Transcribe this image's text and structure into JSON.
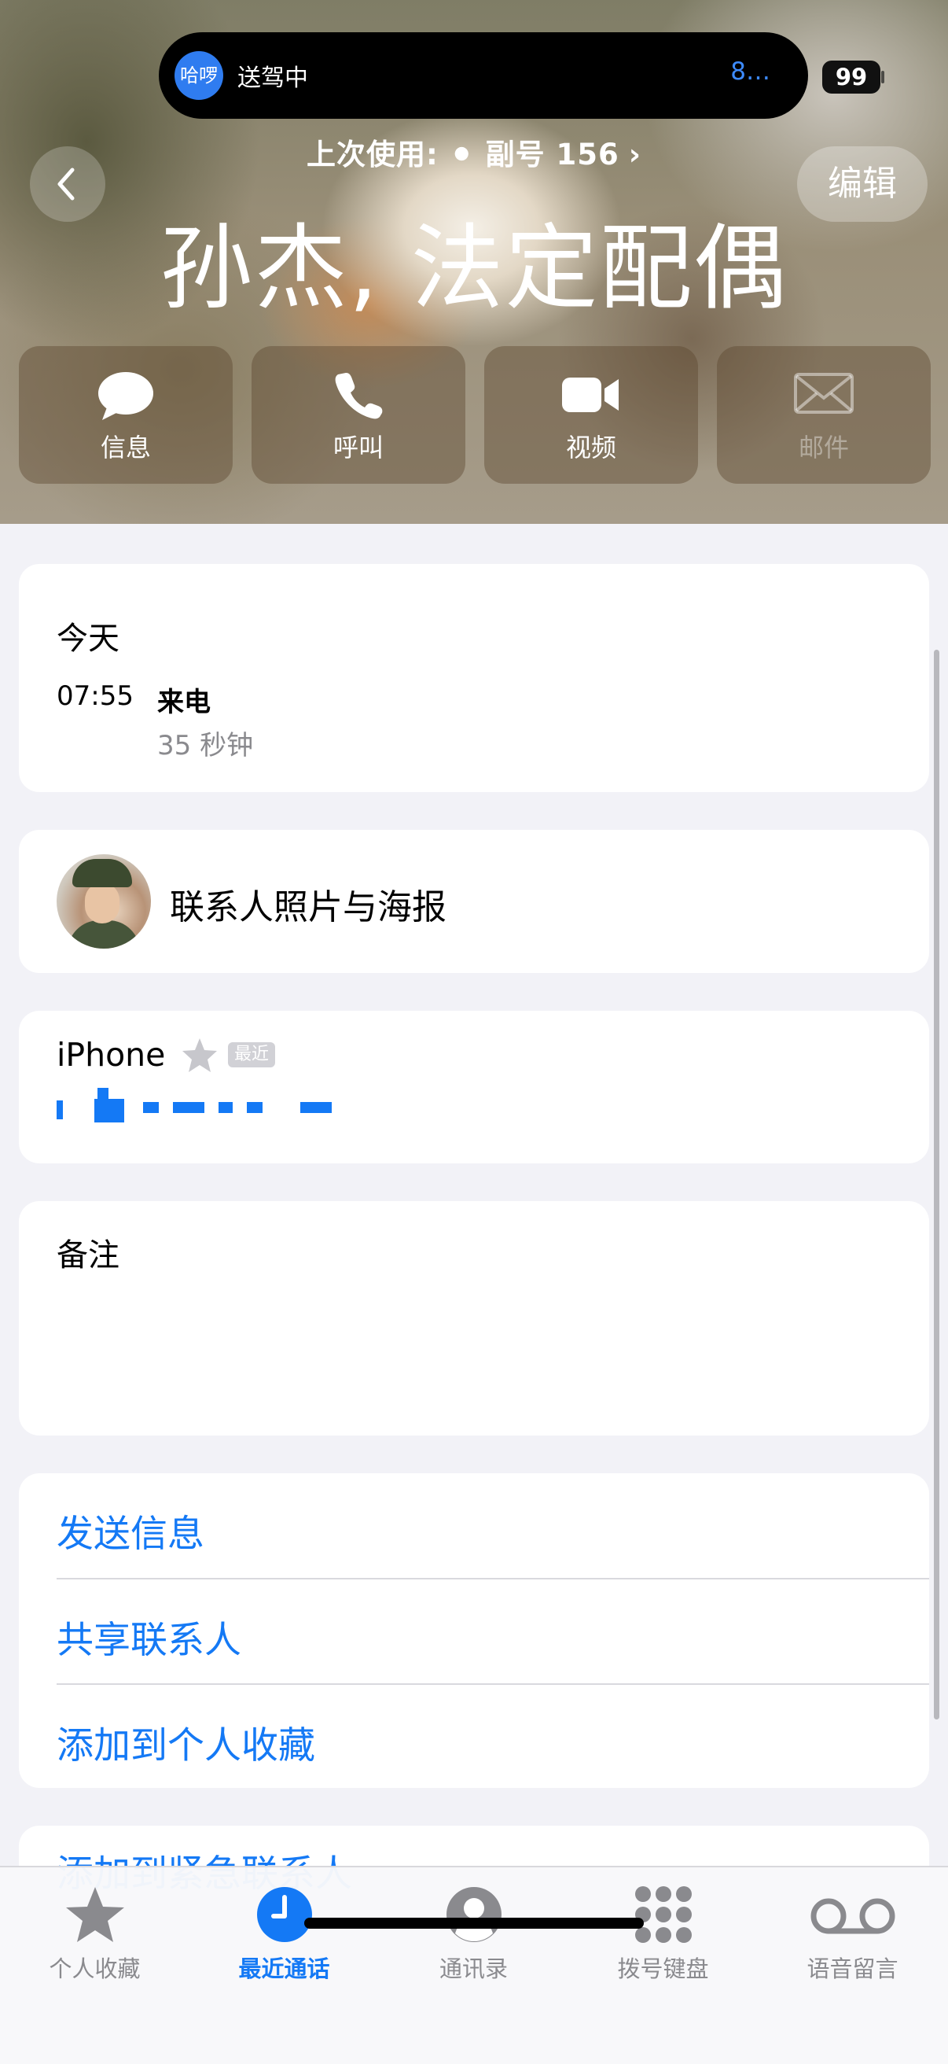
{
  "status": {
    "island_app_icon": "哈啰",
    "island_title": "送驾中",
    "island_right": "8…",
    "battery": "99"
  },
  "header": {
    "last_used": "上次使用: ⚫ 副号 156",
    "last_used_chevron": "›",
    "back_icon": "chevron-left-icon",
    "edit": "编辑",
    "contact_name": "孙杰,  法定配偶"
  },
  "actions": [
    {
      "label": "信息",
      "icon": "message-bubble-icon",
      "enabled": true
    },
    {
      "label": "呼叫",
      "icon": "phone-icon",
      "enabled": true
    },
    {
      "label": "视频",
      "icon": "video-camera-icon",
      "enabled": true
    },
    {
      "label": "邮件",
      "icon": "mail-envelope-icon",
      "enabled": false
    }
  ],
  "recent_calls": {
    "title": "今天",
    "entries": [
      {
        "time": "07:55",
        "type": "来电",
        "duration": "35 秒钟"
      }
    ]
  },
  "photo_poster": {
    "label": "联系人照片与海报"
  },
  "phone": {
    "label": "iPhone",
    "star_icon": "star-icon",
    "recent_badge": "最近",
    "number_redacted": true
  },
  "notes": {
    "label": "备注"
  },
  "links": [
    "发送信息",
    "共享联系人",
    "添加到个人收藏"
  ],
  "peek_link": "添加到紧急联系人",
  "tabbar": [
    {
      "label": "个人收藏",
      "icon": "star-icon",
      "active": false
    },
    {
      "label": "最近通话",
      "icon": "clock-icon",
      "active": true
    },
    {
      "label": "通讯录",
      "icon": "person-circle-icon",
      "active": false
    },
    {
      "label": "拨号键盘",
      "icon": "keypad-icon",
      "active": false
    },
    {
      "label": "语音留言",
      "icon": "voicemail-icon",
      "active": false
    }
  ],
  "colors": {
    "accent": "#1479f5",
    "background": "#f2f2f7",
    "secondary_text": "#8a8a8e"
  }
}
